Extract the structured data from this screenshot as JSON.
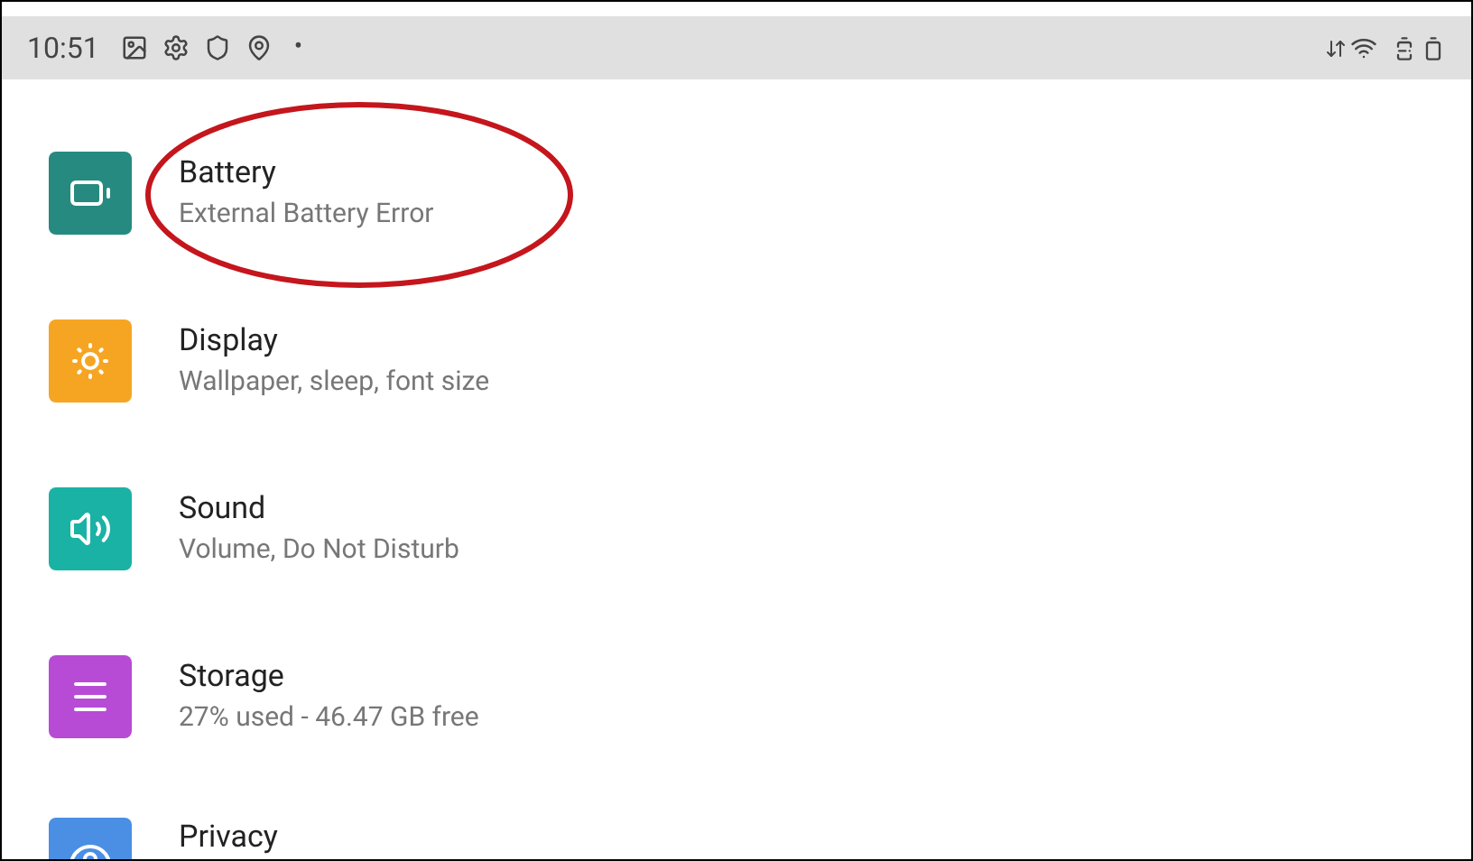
{
  "status_bar": {
    "time": "10:51",
    "dot": "•"
  },
  "settings": [
    {
      "kind": "battery",
      "title": "Battery",
      "subtitle": "External Battery Error",
      "color": "#268a80"
    },
    {
      "kind": "display",
      "title": "Display",
      "subtitle": "Wallpaper, sleep, font size",
      "color": "#f6a523"
    },
    {
      "kind": "sound",
      "title": "Sound",
      "subtitle": "Volume, Do Not Disturb",
      "color": "#1ab2a5"
    },
    {
      "kind": "storage",
      "title": "Storage",
      "subtitle": "27% used - 46.47 GB free",
      "color": "#b74bd6"
    },
    {
      "kind": "privacy",
      "title": "Privacy",
      "color": "#4a8fe4"
    }
  ]
}
